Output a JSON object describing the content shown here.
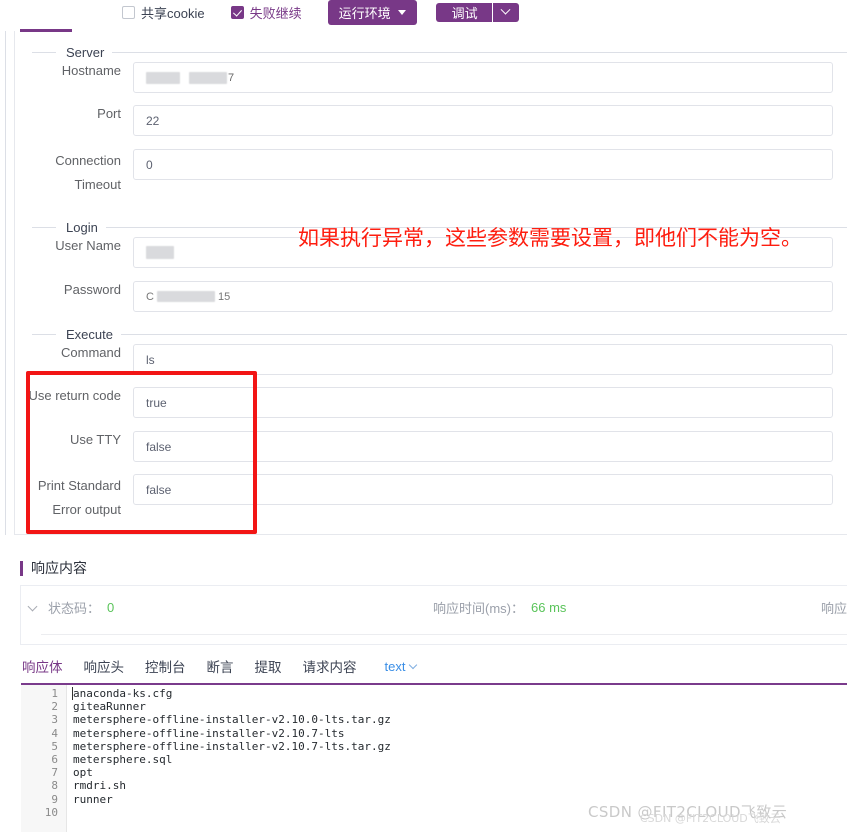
{
  "toolbar": {
    "share_cookie_label": "共享cookie",
    "share_cookie_checked": false,
    "fail_continue_label": "失败继续",
    "fail_continue_checked": true,
    "env_button_label": "运行环境",
    "debug_button_label": "调试"
  },
  "form": {
    "groups": [
      {
        "title": "Server"
      },
      {
        "title": "Login"
      },
      {
        "title": "Execute"
      }
    ],
    "fields": [
      {
        "label": "Hostname",
        "value": "",
        "redacted": true
      },
      {
        "label": "Port",
        "value": "22",
        "redacted": false
      },
      {
        "label": "Connection Timeout",
        "value": "0",
        "redacted": false
      },
      {
        "label": "User Name",
        "value": "",
        "redacted": true
      },
      {
        "label": "Password",
        "value": "C          15",
        "redacted": true
      },
      {
        "label": "Command",
        "value": "ls",
        "redacted": false
      },
      {
        "label": "Use return code",
        "value": "true",
        "redacted": false
      },
      {
        "label": "Use TTY",
        "value": "false",
        "redacted": false
      },
      {
        "label": "Print Standard Error output",
        "value": "false",
        "redacted": false
      }
    ]
  },
  "annotation": {
    "text": "如果执行异常，这些参数需要设置，即他们不能为空。",
    "color": "#fe1d0f",
    "highlight_box_color": "#f21515"
  },
  "response": {
    "section_title": "响应内容",
    "status_label": "状态码：",
    "status_value": "0",
    "time_label": "响应时间(ms)：",
    "time_value": "66 ms",
    "size_label": "响应",
    "tabs": [
      {
        "label": "响应体",
        "active": true
      },
      {
        "label": "响应头",
        "active": false
      },
      {
        "label": "控制台",
        "active": false
      },
      {
        "label": "断言",
        "active": false
      },
      {
        "label": "提取",
        "active": false
      },
      {
        "label": "请求内容",
        "active": false
      }
    ],
    "format_select_value": "text"
  },
  "editor": {
    "line_numbers": [
      "1",
      "2",
      "3",
      "4",
      "5",
      "6",
      "7",
      "8",
      "9",
      "10"
    ],
    "lines": [
      "anaconda-ks.cfg",
      "giteaRunner",
      "metersphere-offline-installer-v2.10.0-lts.tar.gz",
      "metersphere-offline-installer-v2.10.7-lts",
      "metersphere-offline-installer-v2.10.7-lts.tar.gz",
      "metersphere.sql",
      "opt",
      "rmdri.sh",
      "runner",
      ""
    ]
  },
  "watermark": {
    "text": "CSDN @FIT2CLOUD飞致云",
    "text2": "CSDN @FIT2CLOUD飞致云"
  },
  "colors": {
    "accent_purple": "#783887",
    "status_green": "#5ac45a",
    "link_blue": "#3a8ee6",
    "annotation_red": "#fe1d0f"
  }
}
